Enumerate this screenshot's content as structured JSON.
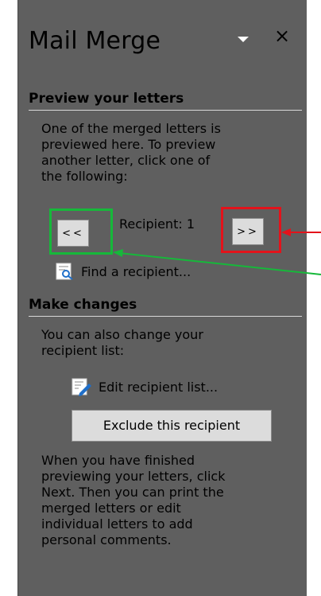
{
  "pane": {
    "title": "Mail Merge",
    "close_label": "×"
  },
  "preview": {
    "heading": "Preview your letters",
    "lines": [
      "One of the merged letters is",
      "previewed here. To preview",
      "another letter, click one of",
      "the following:"
    ],
    "prev_label": "<<",
    "next_label": ">>",
    "recipient_label": "Recipient: 1",
    "find_label": "Find a recipient..."
  },
  "changes": {
    "heading": "Make changes",
    "lines": [
      "You can also change your",
      "recipient list:"
    ],
    "edit_label": "Edit recipient list...",
    "exclude_label": "Exclude this recipient",
    "finish_lines": [
      "When you have finished",
      "previewing your letters, click",
      "Next. Then you can print the",
      "merged letters or edit",
      "individual letters to add",
      "personal comments."
    ]
  },
  "annotations": {
    "green": "#16b83a",
    "red": "#e3131b"
  }
}
